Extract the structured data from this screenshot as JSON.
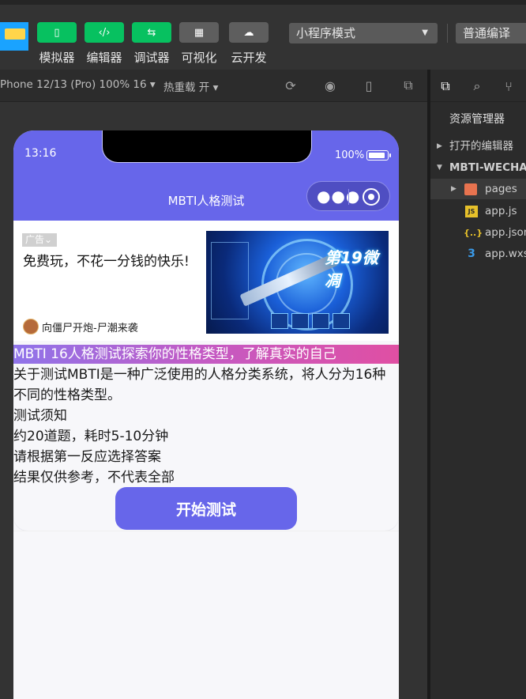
{
  "toolbar": {
    "tools": [
      {
        "label": "模拟器",
        "icon": "phone-icon"
      },
      {
        "label": "编辑器",
        "icon": "code-icon"
      },
      {
        "label": "调试器",
        "icon": "debug-icon"
      },
      {
        "label": "可视化",
        "icon": "layout-icon"
      },
      {
        "label": "云开发",
        "icon": "cloud-icon"
      }
    ],
    "mode_select": "小程序模式",
    "compile_select": "普通编译"
  },
  "subbar": {
    "device": "Phone 12/13 (Pro) 100% 16 ▾",
    "hot_reload": "热重载 开 ▾"
  },
  "phone": {
    "time": "13:16",
    "battery": "100%",
    "nav_title": "MBTI人格测试",
    "ad": {
      "tag": "广告",
      "text": "免费玩，不花一分钱的快乐!",
      "source": "向僵尸开炮-尸潮来袭",
      "image_title": "第19微凋"
    },
    "headline": "MBTI 16人格测试探索你的性格类型，了解真实的自己",
    "paragraphs": [
      "关于测试MBTI是一种广泛使用的人格分类系统，将人分为16种不同的性格类型。",
      "测试须知",
      "约20道题，耗时5-10分钟",
      "请根据第一反应选择答案",
      "结果仅供参考，不代表全部"
    ],
    "start_button": "开始测试"
  },
  "explorer": {
    "heading": "资源管理器",
    "open_editors": "打开的编辑器",
    "project": "MBTI-WECHAT",
    "items": [
      {
        "name": "pages",
        "type": "folder"
      },
      {
        "name": "app.js",
        "type": "js"
      },
      {
        "name": "app.json",
        "type": "json"
      },
      {
        "name": "app.wxss",
        "type": "css"
      }
    ]
  },
  "colors": {
    "accent": "#6766ea",
    "wechat_green": "#07c160"
  }
}
